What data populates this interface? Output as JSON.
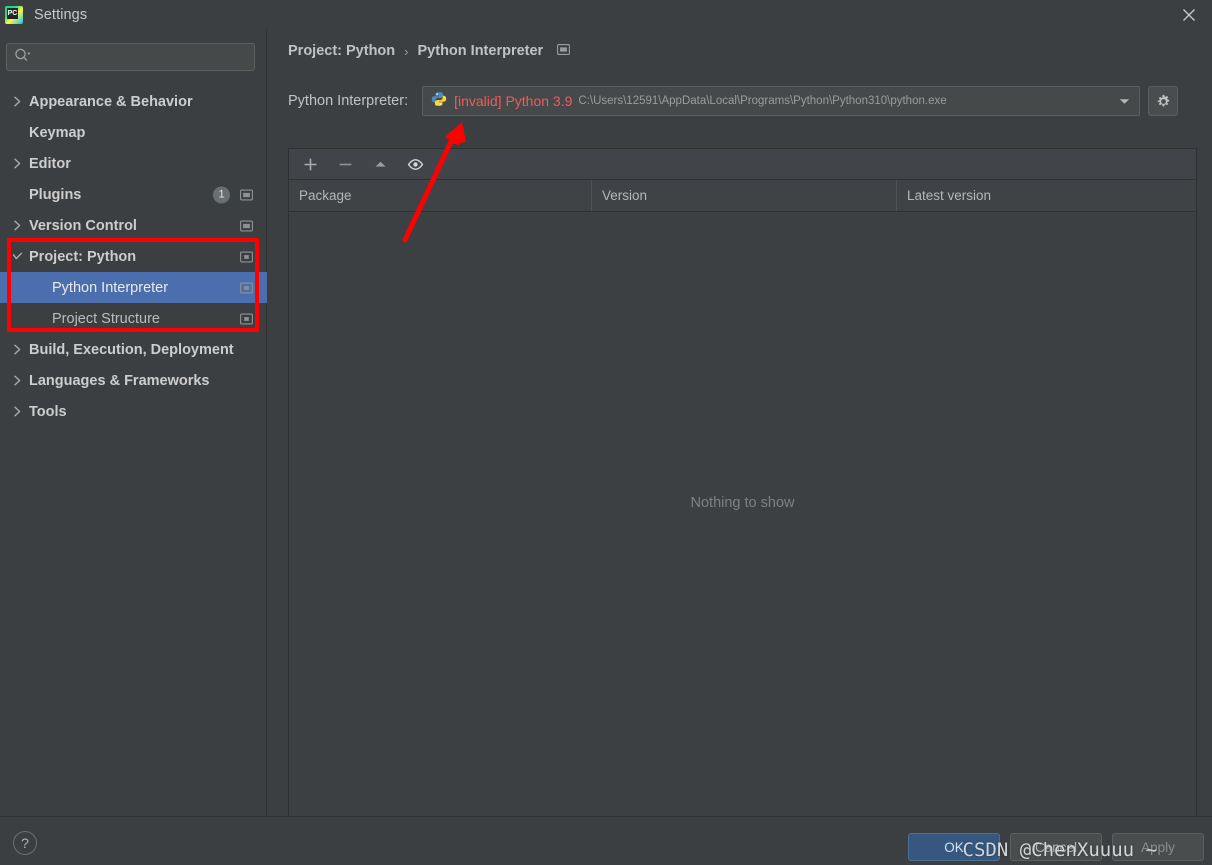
{
  "window": {
    "title": "Settings",
    "logo_icon": "pycharm-logo-icon",
    "logo_text": "PC",
    "close_icon": "close-icon"
  },
  "sidebar": {
    "search": {
      "placeholder": "",
      "value": "",
      "icon": "search-icon"
    },
    "items": [
      {
        "label": "Appearance & Behavior",
        "expandable": true,
        "expanded": false,
        "bold": true,
        "child": false,
        "selected": false,
        "badge": "",
        "trail_icon": ""
      },
      {
        "label": "Keymap",
        "expandable": false,
        "expanded": false,
        "bold": true,
        "child": false,
        "selected": false,
        "badge": "",
        "trail_icon": ""
      },
      {
        "label": "Editor",
        "expandable": true,
        "expanded": false,
        "bold": true,
        "child": false,
        "selected": false,
        "badge": "",
        "trail_icon": ""
      },
      {
        "label": "Plugins",
        "expandable": false,
        "expanded": false,
        "bold": true,
        "child": false,
        "selected": false,
        "badge": "1",
        "trail_icon": "monitor-icon"
      },
      {
        "label": "Version Control",
        "expandable": true,
        "expanded": false,
        "bold": true,
        "child": false,
        "selected": false,
        "badge": "",
        "trail_icon": "monitor-icon"
      },
      {
        "label": "Project: Python",
        "expandable": true,
        "expanded": true,
        "bold": true,
        "child": false,
        "selected": false,
        "badge": "",
        "trail_icon": "project-monitor-icon"
      },
      {
        "label": "Python Interpreter",
        "expandable": false,
        "expanded": false,
        "bold": false,
        "child": true,
        "selected": true,
        "badge": "",
        "trail_icon": "project-monitor-icon"
      },
      {
        "label": "Project Structure",
        "expandable": false,
        "expanded": false,
        "bold": false,
        "child": true,
        "selected": false,
        "badge": "",
        "trail_icon": "project-monitor-icon"
      },
      {
        "label": "Build, Execution, Deployment",
        "expandable": true,
        "expanded": false,
        "bold": true,
        "child": false,
        "selected": false,
        "badge": "",
        "trail_icon": ""
      },
      {
        "label": "Languages & Frameworks",
        "expandable": true,
        "expanded": false,
        "bold": true,
        "child": false,
        "selected": false,
        "badge": "",
        "trail_icon": ""
      },
      {
        "label": "Tools",
        "expandable": true,
        "expanded": false,
        "bold": true,
        "child": false,
        "selected": false,
        "badge": "",
        "trail_icon": ""
      }
    ]
  },
  "main": {
    "breadcrumb": {
      "root": "Project: Python",
      "separator": "›",
      "leaf": "Python Interpreter",
      "icon": "monitor-icon"
    },
    "interpreter": {
      "label": "Python Interpreter:",
      "icon": "python-icon",
      "name": "[invalid] Python 3.9",
      "name_color": "#f05b5b",
      "path": "C:\\Users\\12591\\AppData\\Local\\Programs\\Python\\Python310\\python.exe",
      "dropdown_icon": "chevron-down-icon",
      "settings_icon": "gear-icon"
    },
    "packages": {
      "toolbar": [
        {
          "name": "add-package-button",
          "icon": "plus-icon"
        },
        {
          "name": "remove-package-button",
          "icon": "minus-icon"
        },
        {
          "name": "upgrade-package-button",
          "icon": "arrow-up-icon"
        },
        {
          "name": "show-early-releases-button",
          "icon": "eye-icon"
        }
      ],
      "columns": [
        "Package",
        "Version",
        "Latest version"
      ],
      "rows": [],
      "empty_message": "Nothing to show"
    }
  },
  "footer": {
    "help_icon": "question-icon",
    "help_label": "?",
    "ok_label": "OK",
    "cancel_label": "Cancel",
    "apply_label": "Apply",
    "watermark": "CSDN @ChenXuuuu ~"
  },
  "annotations": {
    "highlight_color": "#fe0000",
    "arrow_name": "red-arrow-annotation",
    "box_name": "red-highlight-box-annotation"
  }
}
